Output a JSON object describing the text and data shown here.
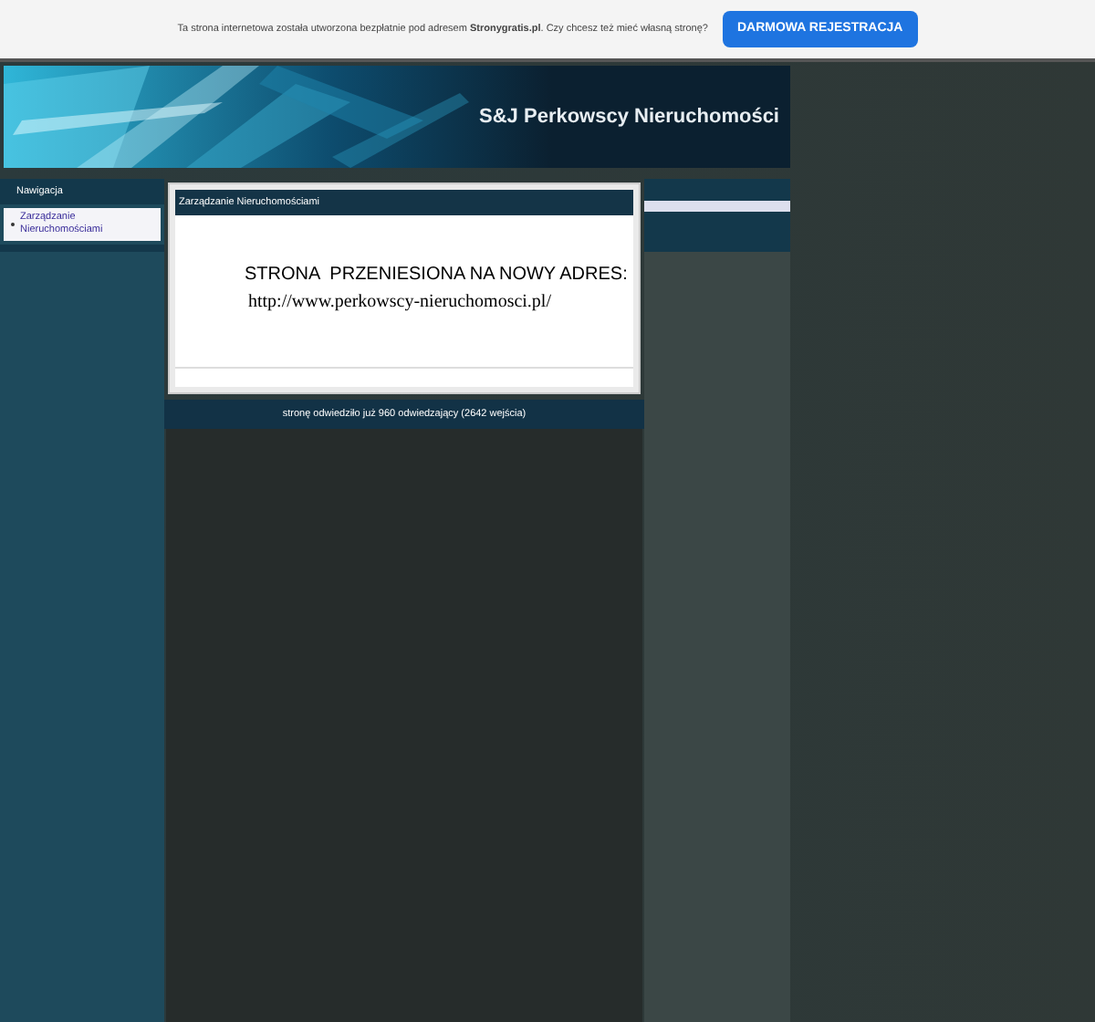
{
  "promo_bar": {
    "text": "Ta strona internetowa została utworzona bezpłatnie pod adresem **Stronygratis.pl**. Czy chcesz też mieć własną stronę?",
    "button": "DARMOWA REJESTRACJA"
  },
  "header": {
    "title": "S&J Perkowscy Nieruchomości"
  },
  "sidebar": {
    "title": "Nawigacja",
    "items": [
      {
        "label": "Zarządzanie Nieruchomościami",
        "selected": true
      }
    ]
  },
  "content": {
    "title": "Zarządzanie Nieruchomościami",
    "heading": "STRONA  PRZENIESIONA NA NOWY ADRES:",
    "link": "http://www.perkowscy-nieruchomosci.pl/"
  },
  "footer": {
    "text": "stronę odwiedziło już 960 odwiedzający (2642 wejścia)"
  }
}
